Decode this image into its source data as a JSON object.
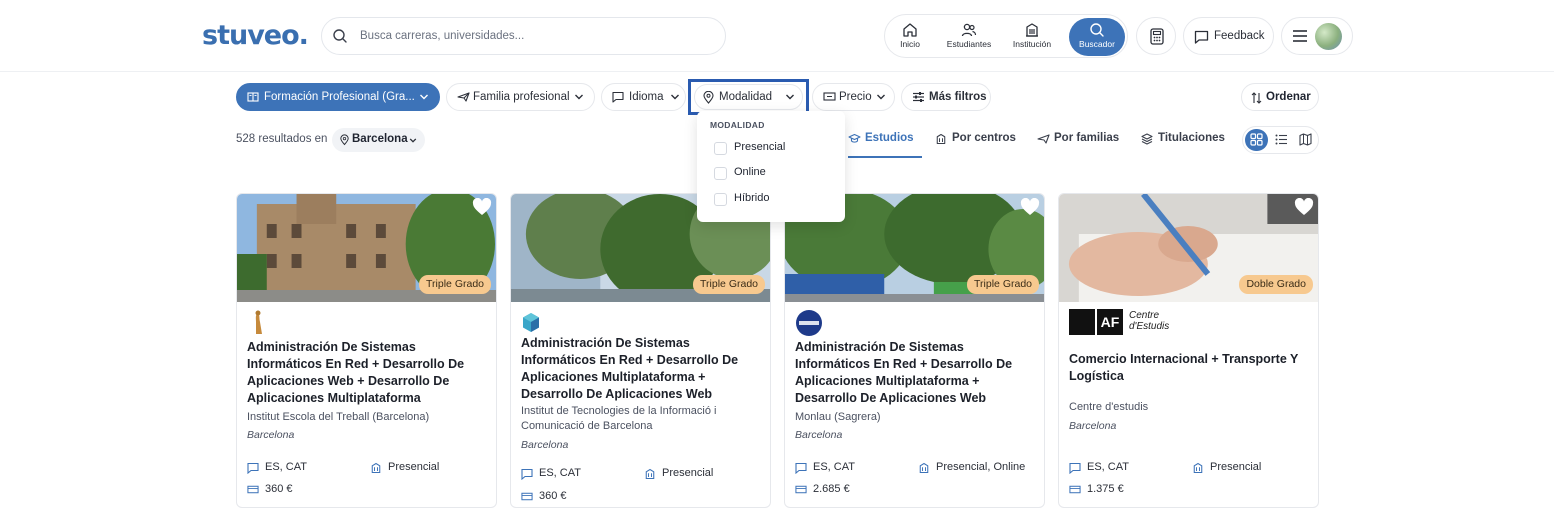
{
  "header": {
    "logo": "stuveo.",
    "search_placeholder": "Busca carreras, universidades...",
    "nav": [
      {
        "label": "Inicio"
      },
      {
        "label": "Estudiantes"
      },
      {
        "label": "Institución"
      },
      {
        "label": "Buscador"
      }
    ],
    "feedback": "Feedback"
  },
  "filters": {
    "study_type": "Formación Profesional (Gra...",
    "family": "Familia profesional",
    "language": "Idioma",
    "modality": "Modalidad",
    "price": "Precio",
    "more": "Más filtros",
    "sort": "Ordenar"
  },
  "results": {
    "count_text": "528 resultados en",
    "location": "Barcelona"
  },
  "tabs": [
    {
      "label": "Estudios"
    },
    {
      "label": "Por centros"
    },
    {
      "label": "Por familias"
    },
    {
      "label": "Titulaciones"
    }
  ],
  "dropdown": {
    "title": "MODALIDAD",
    "options": [
      "Presencial",
      "Online",
      "Híbrido"
    ]
  },
  "cards": [
    {
      "badge": "Triple Grado",
      "title": "Administración De Sistemas Informáticos En Red + Desarrollo De Aplicaciones Web + Desarrollo De Aplicaciones Multiplataforma",
      "institution": "Institut Escola del Treball (Barcelona)",
      "city": "Barcelona",
      "languages": "ES, CAT",
      "modality": "Presencial",
      "price": "360 €"
    },
    {
      "badge": "Triple Grado",
      "title": "Administración De Sistemas Informáticos En Red + Desarrollo De Aplicaciones Multiplataforma + Desarrollo De Aplicaciones Web",
      "institution": "Institut de Tecnologies de la Informació i Comunicació de Barcelona",
      "city": "Barcelona",
      "languages": "ES, CAT",
      "modality": "Presencial",
      "price": "360 €"
    },
    {
      "badge": "Triple Grado",
      "title": "Administración De Sistemas Informáticos En Red + Desarrollo De Aplicaciones Multiplataforma + Desarrollo De Aplicaciones Web",
      "institution": "Monlau (Sagrera)",
      "city": "Barcelona",
      "languages": "ES, CAT",
      "modality": "Presencial, Online",
      "price": "2.685 €"
    },
    {
      "badge": "Doble Grado",
      "title": "Comercio Internacional + Transporte Y Logística",
      "institution": "Centre d'estudis",
      "city": "Barcelona",
      "languages": "ES, CAT",
      "modality": "Presencial",
      "price": "1.375 €",
      "logo_text_1": "Centre",
      "logo_text_2": "d'Estudis"
    }
  ],
  "colors": {
    "brand": "#3d73b8",
    "highlight_border": "#2a5bb0",
    "badge": "#f7c98f"
  }
}
